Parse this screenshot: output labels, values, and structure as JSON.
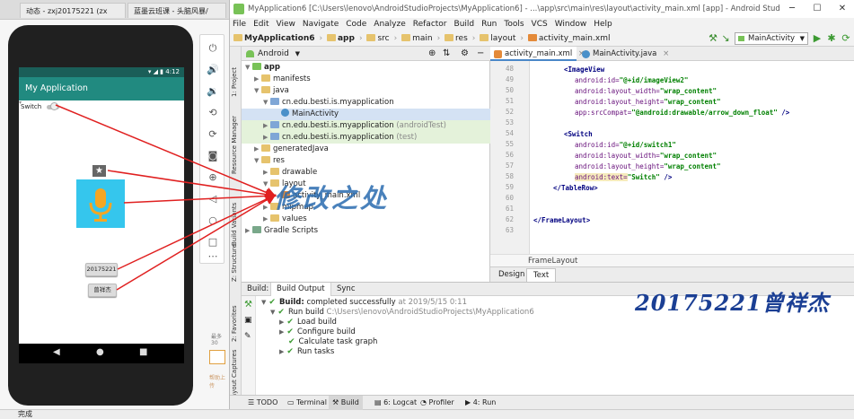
{
  "browser": {
    "tabs": [
      {
        "label": "动态 - zxj20175221 (zx"
      },
      {
        "label": "蓝墨云班课 - 头脑风暴/"
      }
    ],
    "status": "完成",
    "side_texts": [
      "最多 30",
      "帮助上传"
    ]
  },
  "studio": {
    "title": "MyApplication6 [C:\\Users\\lenovo\\AndroidStudioProjects\\MyApplication6] - ...\\app\\src\\main\\res\\layout\\activity_main.xml [app] - Android Studio",
    "menu": [
      "File",
      "Edit",
      "View",
      "Navigate",
      "Code",
      "Analyze",
      "Refactor",
      "Build",
      "Run",
      "Tools",
      "VCS",
      "Window",
      "Help"
    ],
    "breadcrumbs": [
      "MyApplication6",
      "app",
      "src",
      "main",
      "res",
      "layout",
      "activity_main.xml"
    ],
    "run_config": "MainActivity",
    "left_tabs": [
      "1: Project",
      "Resource Manager",
      "Build Variants",
      "Z: Structure",
      "2: Favorites",
      "Layout Captures"
    ],
    "project_view": "Android",
    "tree": [
      {
        "label": "app",
        "type": "folder",
        "bold": true
      },
      {
        "label": "manifests",
        "type": "folder"
      },
      {
        "label": "java",
        "type": "folder"
      },
      {
        "label": "cn.edu.besti.is.myapplication",
        "type": "package"
      },
      {
        "label": "MainActivity",
        "type": "class"
      },
      {
        "label": "cn.edu.besti.is.myapplication",
        "suffix": "(androidTest)",
        "type": "package"
      },
      {
        "label": "cn.edu.besti.is.myapplication",
        "suffix": "(test)",
        "type": "package"
      },
      {
        "label": "generatedJava",
        "type": "folder"
      },
      {
        "label": "res",
        "type": "folder"
      },
      {
        "label": "drawable",
        "type": "folder"
      },
      {
        "label": "layout",
        "type": "folder"
      },
      {
        "label": "activity_main.xml",
        "type": "file"
      },
      {
        "label": "mipmap",
        "type": "folder"
      },
      {
        "label": "values",
        "type": "folder"
      },
      {
        "label": "Gradle Scripts",
        "type": "folder"
      }
    ],
    "editor_tabs": [
      "activity_main.xml",
      "MainActivity.java"
    ],
    "line_numbers": [
      "48",
      "49",
      "50",
      "51",
      "52",
      "53",
      "54",
      "55",
      "56",
      "57",
      "58",
      "59",
      "60",
      "61",
      "62",
      "63"
    ],
    "code": {
      "l1": "<ImageView",
      "l2a": "android:id=",
      "l2b": "\"@+id/imageView2\"",
      "l3a": "android:layout_width=",
      "l3b": "\"wrap_content\"",
      "l4a": "android:layout_height=",
      "l4b": "\"wrap_content\"",
      "l5a": "app:srcCompat=",
      "l5b": "\"@android:drawable/arrow_down_float\"",
      "l5c": " />",
      "l6": "<Switch",
      "l7a": "android:id=",
      "l7b": "\"@+id/switch1\"",
      "l8a": "android:layout_width=",
      "l8b": "\"wrap_content\"",
      "l9a": "android:layout_height=",
      "l9b": "\"wrap_content\"",
      "l10a": "android:text=",
      "l10b": "\"Switch\"",
      "l10c": " />",
      "l11": "</TableRow>",
      "l12": "</FrameLayout>"
    },
    "code_footer": "FrameLayout",
    "design_tabs": [
      "Design",
      "Text"
    ],
    "build": {
      "tabs": [
        "Build:",
        "Build Output",
        "Sync"
      ],
      "summary_bold": "Build:",
      "summary": " completed successfully",
      "summary_time": " at 2019/5/15 0:11",
      "run_build": "Run build",
      "run_path": " C:\\Users\\lenovo\\AndroidStudioProjects\\MyApplication6",
      "steps": [
        "Load build",
        "Configure build",
        "Calculate task graph",
        "Run tasks"
      ]
    },
    "bottom_tabs": [
      "TODO",
      "Terminal",
      "Build",
      "6: Logcat",
      "Profiler",
      "4: Run"
    ]
  },
  "phone": {
    "time": "4:12",
    "app_title": "My Application",
    "switch_text": "Switch",
    "button_number": "20175221",
    "button_name": "曾祥杰"
  },
  "annotations": {
    "edit_note": "修改之处",
    "signature": "20175221曾祥杰"
  },
  "colors": {
    "app_bar": "#218a80",
    "status_bar": "#1a5e58",
    "arrow": "#e02020",
    "image_tile": "#35c6ed",
    "mic": "#f5a623",
    "signature": "#1b3f94"
  }
}
